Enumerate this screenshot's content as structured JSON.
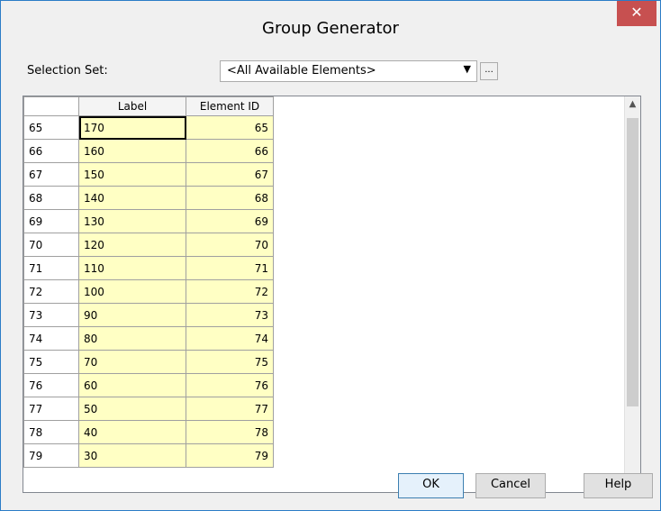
{
  "window": {
    "title": "Group Generator"
  },
  "selection": {
    "label": "Selection Set:",
    "value": "<All Available Elements>",
    "ellipsis": "..."
  },
  "grid": {
    "columns": [
      "Label",
      "Element ID"
    ],
    "rows": [
      {
        "row": "65",
        "label": "170",
        "id": "65"
      },
      {
        "row": "66",
        "label": "160",
        "id": "66"
      },
      {
        "row": "67",
        "label": "150",
        "id": "67"
      },
      {
        "row": "68",
        "label": "140",
        "id": "68"
      },
      {
        "row": "69",
        "label": "130",
        "id": "69"
      },
      {
        "row": "70",
        "label": "120",
        "id": "70"
      },
      {
        "row": "71",
        "label": "110",
        "id": "71"
      },
      {
        "row": "72",
        "label": "100",
        "id": "72"
      },
      {
        "row": "73",
        "label": "90",
        "id": "73"
      },
      {
        "row": "74",
        "label": "80",
        "id": "74"
      },
      {
        "row": "75",
        "label": "70",
        "id": "75"
      },
      {
        "row": "76",
        "label": "60",
        "id": "76"
      },
      {
        "row": "77",
        "label": "50",
        "id": "77"
      },
      {
        "row": "78",
        "label": "40",
        "id": "78"
      },
      {
        "row": "79",
        "label": "30",
        "id": "79"
      }
    ]
  },
  "buttons": {
    "ok": "OK",
    "cancel": "Cancel",
    "help": "Help"
  }
}
